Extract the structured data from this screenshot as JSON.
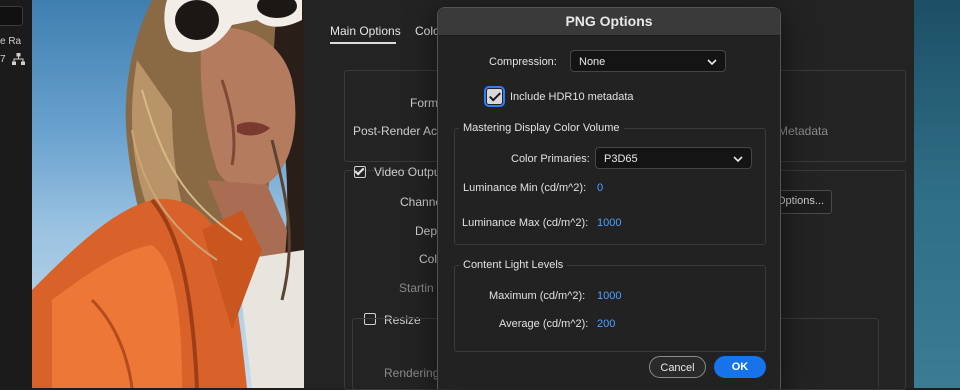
{
  "left_strip": {
    "text_ra": "e Ra",
    "text_7": "7",
    "network_icon": "network-icon"
  },
  "panel": {
    "tabs": [
      "Main Options",
      "Colo"
    ],
    "format_label": "Form",
    "post_render_label": "Post-Render Actic",
    "metadata_label": "Metadata",
    "video_output_label": "Video Output",
    "channels_label": "Channe",
    "depth_label": "Dept",
    "color_label": "Col",
    "starting_label": "Startin",
    "resize_label": "Resize",
    "rendering_label": "Rendering",
    "options_button_label": "Options..."
  },
  "dialog": {
    "title": "PNG Options",
    "compression_label": "Compression:",
    "compression_value": "None",
    "hdr10_label": "Include HDR10 metadata",
    "hdr10_checked": true,
    "mastering_group_title": "Mastering Display Color Volume",
    "color_primaries_label": "Color Primaries:",
    "color_primaries_value": "P3D65",
    "lum_min_label": "Luminance Min (cd/m^2):",
    "lum_min_value": "0",
    "lum_max_label": "Luminance Max (cd/m^2):",
    "lum_max_value": "1000",
    "content_light_group_title": "Content Light Levels",
    "maximum_label": "Maximum (cd/m^2):",
    "maximum_value": "1000",
    "average_label": "Average (cd/m^2):",
    "average_value": "200",
    "cancel_label": "Cancel",
    "ok_label": "OK"
  },
  "colors": {
    "accent": "#1673ea",
    "value_blue": "#4ea2ff",
    "dialog_bg": "#222222",
    "titlebar_bg": "#3a3a3a"
  }
}
